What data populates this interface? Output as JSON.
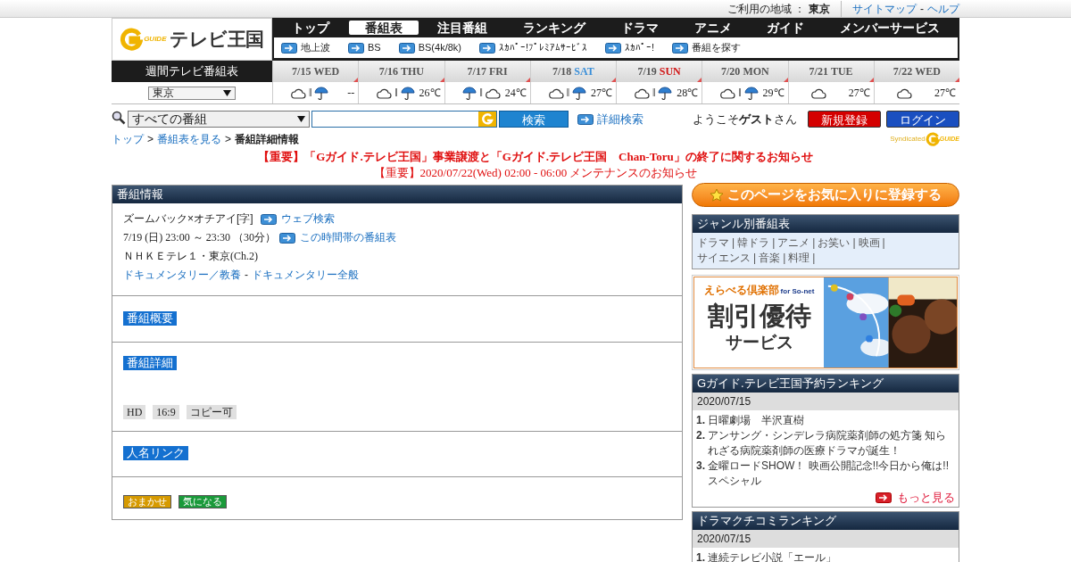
{
  "top_bar": {
    "region_label": "ご利用の地域 ：",
    "region": "東京",
    "links": [
      "サイトマップ",
      "ヘルプ"
    ],
    "link_separator": "-"
  },
  "logo": {
    "mark": "GUIDE",
    "name": "テレビ王国"
  },
  "nav_tabs": [
    {
      "label": "トップ",
      "selected": false
    },
    {
      "label": "番組表",
      "selected": true
    },
    {
      "label": "注目番組",
      "selected": false
    },
    {
      "label": "ランキング",
      "selected": false
    },
    {
      "label": "ドラマ",
      "selected": false
    },
    {
      "label": "アニメ",
      "selected": false
    },
    {
      "label": "ガイド",
      "selected": false
    },
    {
      "label": "メンバーサービス",
      "selected": false
    }
  ],
  "sub_nav": [
    "地上波",
    "BS",
    "BS(4k/8k)",
    "ｽｶﾊﾟｰ!ﾌﾟﾚﾐｱﾑｻｰﾋﾞｽ",
    "ｽｶﾊﾟｰ!",
    "番組を探す"
  ],
  "weekly": {
    "title": "週間テレビ番組表",
    "region_select": "東京",
    "days": [
      {
        "date": "7/15",
        "weekday": "WED",
        "color": "#555555",
        "weather": [
          {
            "kind": "cloud"
          },
          {
            "kind": "sep",
            "text": "‖"
          },
          {
            "kind": "umbrella"
          }
        ],
        "temp": "--"
      },
      {
        "date": "7/16",
        "weekday": "THU",
        "color": "#555555",
        "weather": [
          {
            "kind": "cloud"
          },
          {
            "kind": "sep",
            "text": "‖"
          },
          {
            "kind": "umbrella"
          }
        ],
        "temp": "26℃"
      },
      {
        "date": "7/17",
        "weekday": "FRI",
        "color": "#555555",
        "weather": [
          {
            "kind": "umbrella"
          },
          {
            "kind": "sep",
            "text": "‖"
          },
          {
            "kind": "cloud"
          }
        ],
        "temp": "24℃"
      },
      {
        "date": "7/18",
        "weekday": "SAT",
        "color": "#3a8fd9",
        "weather": [
          {
            "kind": "cloud"
          },
          {
            "kind": "sep",
            "text": "‖"
          },
          {
            "kind": "umbrella"
          }
        ],
        "temp": "27℃"
      },
      {
        "date": "7/19",
        "weekday": "SUN",
        "color": "#d01515",
        "weather": [
          {
            "kind": "cloud"
          },
          {
            "kind": "sep",
            "text": "‖"
          },
          {
            "kind": "umbrella"
          }
        ],
        "temp": "28℃"
      },
      {
        "date": "7/20",
        "weekday": "MON",
        "color": "#555555",
        "weather": [
          {
            "kind": "cloud"
          },
          {
            "kind": "sep",
            "text": "‖"
          },
          {
            "kind": "umbrella"
          }
        ],
        "temp": "29℃"
      },
      {
        "date": "7/21",
        "weekday": "TUE",
        "color": "#555555",
        "weather": [
          {
            "kind": "cloud"
          }
        ],
        "temp": "27℃"
      },
      {
        "date": "7/22",
        "weekday": "WED",
        "color": "#555555",
        "weather": [
          {
            "kind": "cloud"
          }
        ],
        "temp": "27℃"
      }
    ]
  },
  "search": {
    "category": "すべての番組",
    "button": "検索",
    "advanced": "詳細検索"
  },
  "user": {
    "greeting_pre": "ようこそ",
    "guest": "ゲスト",
    "greeting_post": "さん",
    "buttons": [
      {
        "label": "新規登録",
        "color": "#d40000"
      },
      {
        "label": "ログイン",
        "color": "#1a4fc0"
      }
    ]
  },
  "breadcrumb": {
    "links": [
      "トップ",
      "番組表を見る"
    ],
    "separator": ">",
    "current": "番組詳細情報"
  },
  "syndicated": {
    "text": "Syndicated",
    "mark": "GUIDE"
  },
  "notices": [
    "【重要】「Gガイド.テレビ王国」事業譲渡と「Gガイド.テレビ王国　Chan-Toru」の終了に関するお知らせ",
    "【重要】2020/07/22(Wed) 02:00 - 06:00 メンテナンスのお知らせ"
  ],
  "program": {
    "header": "番組情報",
    "title": "ズームバック×オチアイ[字]",
    "web_search": "ウェブ検索",
    "time": "7/19 (日) 23:00 ～ 23:30 （30分）",
    "time_link": "この時間帯の番組表",
    "channel": "ＮＨＫＥテレ１・東京(Ch.2)",
    "genres": [
      "ドキュメンタリー／教養",
      "ドキュメンタリー全般"
    ],
    "genre_separator": "-",
    "summary_label": "番組概要",
    "detail_label": "番組詳細",
    "tags": [
      "HD",
      "16:9",
      "コピー可"
    ],
    "people_label": "人名リンク",
    "actions": [
      {
        "label": "おまかせ",
        "color": "#d69a00"
      },
      {
        "label": "気になる",
        "color": "#1a9a3a"
      }
    ]
  },
  "favorite_button": "このページをお気に入りに登録する",
  "genre_box": {
    "header": "ジャンル別番組表",
    "items": [
      "ドラマ",
      "韓ドラ",
      "アニメ",
      "お笑い",
      "映画",
      "サイエンス",
      "音楽",
      "料理"
    ],
    "separator": "|"
  },
  "banner": {
    "brand": "えらべる倶楽部",
    "brand_suffix": "for So-net",
    "headline": "割引優待",
    "sub": "サービス"
  },
  "rankings": [
    {
      "header": "Gガイド.テレビ王国予約ランキング",
      "date": "2020/07/15",
      "items": [
        {
          "rank": "1.",
          "title": "日曜劇場　半沢直樹"
        },
        {
          "rank": "2.",
          "title": "アンサング・シンデレラ病院薬剤師の処方箋 知られざる病院薬剤師の医療ドラマが誕生！"
        },
        {
          "rank": "3.",
          "title": "金曜ロードSHOW！ 映画公開記念!!今日から俺は!!スペシャル"
        }
      ],
      "more": "もっと見る"
    },
    {
      "header": "ドラマクチコミランキング",
      "date": "2020/07/15",
      "items": [
        {
          "rank": "1.",
          "title": "連続テレビ小説「エール」"
        }
      ]
    }
  ]
}
